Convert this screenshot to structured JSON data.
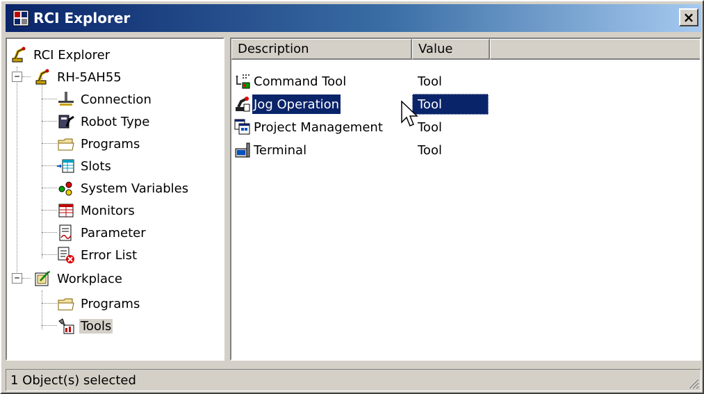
{
  "window": {
    "title": "RCI Explorer",
    "close_label": "×"
  },
  "tree": {
    "items": [
      {
        "label": "RCI Explorer",
        "icon": "robot-icon",
        "expander": ""
      },
      {
        "label": "RH-5AH55",
        "icon": "robot-icon",
        "expander": "−"
      },
      {
        "label": "Connection",
        "icon": "connection-icon",
        "expander": ""
      },
      {
        "label": "Robot Type",
        "icon": "robot-type-icon",
        "expander": ""
      },
      {
        "label": "Programs",
        "icon": "folder-icon",
        "expander": ""
      },
      {
        "label": "Slots",
        "icon": "slots-icon",
        "expander": ""
      },
      {
        "label": "System Variables",
        "icon": "variables-icon",
        "expander": ""
      },
      {
        "label": "Monitors",
        "icon": "monitors-icon",
        "expander": ""
      },
      {
        "label": "Parameter",
        "icon": "parameter-icon",
        "expander": ""
      },
      {
        "label": "Error List",
        "icon": "error-list-icon",
        "expander": ""
      },
      {
        "label": "Workplace",
        "icon": "workplace-icon",
        "expander": "−"
      },
      {
        "label": "Programs",
        "icon": "folder-icon",
        "expander": ""
      },
      {
        "label": "Tools",
        "icon": "tools-icon",
        "expander": ""
      }
    ],
    "selected": "Tools"
  },
  "list": {
    "columns": [
      "Description",
      "Value"
    ],
    "rows": [
      {
        "description": "Command Tool",
        "value": "Tool",
        "icon": "command-tool-icon"
      },
      {
        "description": "Jog Operation",
        "value": "Tool",
        "icon": "jog-operation-icon"
      },
      {
        "description": "Project Management",
        "value": "Tool",
        "icon": "project-management-icon"
      },
      {
        "description": "Terminal",
        "value": "Tool",
        "icon": "terminal-icon"
      }
    ],
    "selected_row": "Jog Operation"
  },
  "status": {
    "text": "1 Object(s) selected"
  },
  "colors": {
    "selection": "#0a246a",
    "face": "#d4d0c8",
    "title_start": "#0a246a",
    "title_end": "#a6caf0"
  }
}
